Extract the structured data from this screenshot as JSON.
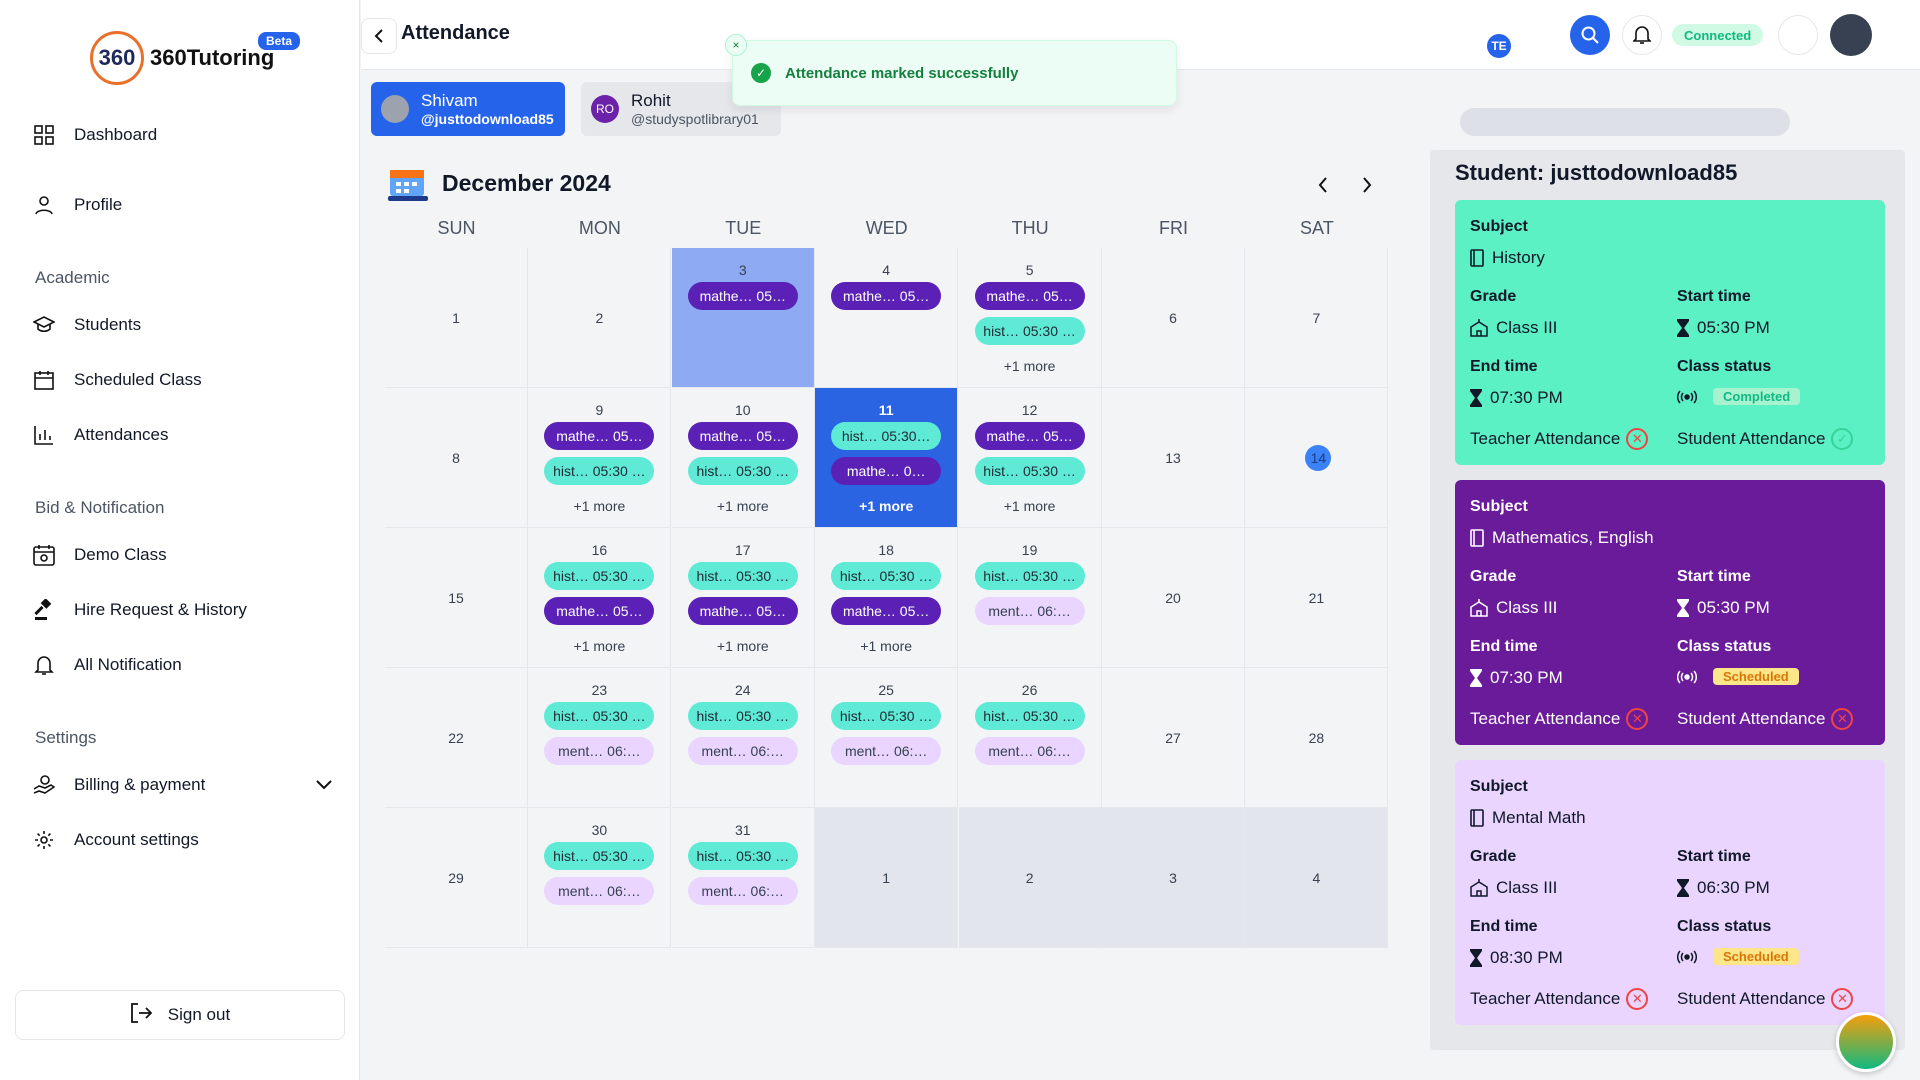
{
  "brand": {
    "mark": "360",
    "name": "360Tutoring",
    "badge": "Beta"
  },
  "sidebar": {
    "items": [
      {
        "label": "Dashboard",
        "icon": "grid-icon"
      },
      {
        "label": "Profile",
        "icon": "user-icon"
      }
    ],
    "sections": [
      {
        "title": "Academic",
        "items": [
          {
            "label": "Students"
          },
          {
            "label": "Scheduled Class"
          },
          {
            "label": "Attendances"
          }
        ]
      },
      {
        "title": "Bid & Notification",
        "items": [
          {
            "label": "Demo Class"
          },
          {
            "label": "Hire Request & History"
          },
          {
            "label": "All Notification"
          }
        ]
      },
      {
        "title": "Settings",
        "items": [
          {
            "label": "Billing & payment"
          },
          {
            "label": "Account settings"
          }
        ]
      }
    ],
    "signout": "Sign out"
  },
  "header": {
    "title": "Attendance",
    "status": "Connected",
    "avatar_initials": "TE"
  },
  "toast": {
    "message": "Attendance marked successfully",
    "close": "×"
  },
  "students": [
    {
      "name": "Shivam",
      "handle": "@justtodownload85",
      "initials": "",
      "active": true
    },
    {
      "name": "Rohit",
      "handle": "@studyspotlibrary01",
      "initials": "RO",
      "active": false
    }
  ],
  "calendar": {
    "month": "December 2024",
    "weekdays": [
      "SUN",
      "MON",
      "TUE",
      "WED",
      "THU",
      "FRI",
      "SAT"
    ],
    "weeks": [
      [
        {
          "d": "1"
        },
        {
          "d": "2"
        },
        {
          "d": "3",
          "state": "sel",
          "ev": [
            [
              "math",
              "mathe…  05…"
            ]
          ]
        },
        {
          "d": "4",
          "ev": [
            [
              "math",
              "mathe…  05…"
            ]
          ]
        },
        {
          "d": "5",
          "ev": [
            [
              "math",
              "mathe…  05…"
            ],
            [
              "hist",
              "hist…  05:30 …"
            ]
          ],
          "more": "+1 more"
        },
        {
          "d": "6"
        },
        {
          "d": "7"
        }
      ],
      [
        {
          "d": "8"
        },
        {
          "d": "9",
          "ev": [
            [
              "math",
              "mathe…  05…"
            ],
            [
              "hist",
              "hist…  05:30 …"
            ]
          ],
          "more": "+1 more"
        },
        {
          "d": "10",
          "ev": [
            [
              "math",
              "mathe…  05…"
            ],
            [
              "hist",
              "hist…  05:30 …"
            ]
          ],
          "more": "+1 more"
        },
        {
          "d": "11",
          "state": "today",
          "ev": [
            [
              "hist",
              "hist…  05:30…"
            ],
            [
              "math",
              "mathe…  0…"
            ]
          ],
          "more": "+1 more"
        },
        {
          "d": "12",
          "ev": [
            [
              "math",
              "mathe…  05…"
            ],
            [
              "hist",
              "hist…  05:30 …"
            ]
          ],
          "more": "+1 more"
        },
        {
          "d": "13"
        },
        {
          "d": "14",
          "state": "circle"
        }
      ],
      [
        {
          "d": "15"
        },
        {
          "d": "16",
          "ev": [
            [
              "hist",
              "hist…  05:30 …"
            ],
            [
              "math",
              "mathe…  05…"
            ]
          ],
          "more": "+1 more"
        },
        {
          "d": "17",
          "ev": [
            [
              "hist",
              "hist…  05:30 …"
            ],
            [
              "math",
              "mathe…  05…"
            ]
          ],
          "more": "+1 more"
        },
        {
          "d": "18",
          "ev": [
            [
              "hist",
              "hist…  05:30 …"
            ],
            [
              "math",
              "mathe…  05…"
            ]
          ],
          "more": "+1 more"
        },
        {
          "d": "19",
          "ev": [
            [
              "hist",
              "hist…  05:30 …"
            ],
            [
              "ment",
              "ment…  06:…"
            ]
          ]
        },
        {
          "d": "20"
        },
        {
          "d": "21"
        }
      ],
      [
        {
          "d": "22"
        },
        {
          "d": "23",
          "ev": [
            [
              "hist",
              "hist…  05:30 …"
            ],
            [
              "ment",
              "ment…  06:…"
            ]
          ]
        },
        {
          "d": "24",
          "ev": [
            [
              "hist",
              "hist…  05:30 …"
            ],
            [
              "ment",
              "ment…  06:…"
            ]
          ]
        },
        {
          "d": "25",
          "ev": [
            [
              "hist",
              "hist…  05:30 …"
            ],
            [
              "ment",
              "ment…  06:…"
            ]
          ]
        },
        {
          "d": "26",
          "ev": [
            [
              "hist",
              "hist…  05:30 …"
            ],
            [
              "ment",
              "ment…  06:…"
            ]
          ]
        },
        {
          "d": "27"
        },
        {
          "d": "28"
        }
      ],
      [
        {
          "d": "29"
        },
        {
          "d": "30",
          "ev": [
            [
              "hist",
              "hist…  05:30 …"
            ],
            [
              "ment",
              "ment…  06:…"
            ]
          ]
        },
        {
          "d": "31",
          "ev": [
            [
              "hist",
              "hist…  05:30 …"
            ],
            [
              "ment",
              "ment…  06:…"
            ]
          ]
        },
        {
          "d": "1",
          "state": "out"
        },
        {
          "d": "2",
          "state": "out"
        },
        {
          "d": "3",
          "state": "out"
        },
        {
          "d": "4",
          "state": "out"
        }
      ]
    ]
  },
  "panel": {
    "title": "Student: justtodownload85",
    "labels": {
      "subject": "Subject",
      "grade": "Grade",
      "start": "Start time",
      "end": "End time",
      "status": "Class status",
      "teacher": "Teacher Attendance",
      "student": "Student Attendance"
    },
    "cards": [
      {
        "subject": "History",
        "grade": "Class III",
        "start": "05:30 PM",
        "end": "07:30 PM",
        "status": "Completed",
        "teacher_ok": false,
        "student_ok": true
      },
      {
        "subject": "Mathematics, English",
        "grade": "Class III",
        "start": "05:30 PM",
        "end": "07:30 PM",
        "status": "Scheduled",
        "teacher_ok": false,
        "student_ok": false
      },
      {
        "subject": "Mental Math",
        "grade": "Class III",
        "start": "06:30 PM",
        "end": "08:30 PM",
        "status": "Scheduled",
        "teacher_ok": false,
        "student_ok": false
      }
    ]
  },
  "colors": {
    "accent": "#2563eb",
    "math": "#5b21b6",
    "history": "#5eead4",
    "mental": "#e9d5ff"
  }
}
